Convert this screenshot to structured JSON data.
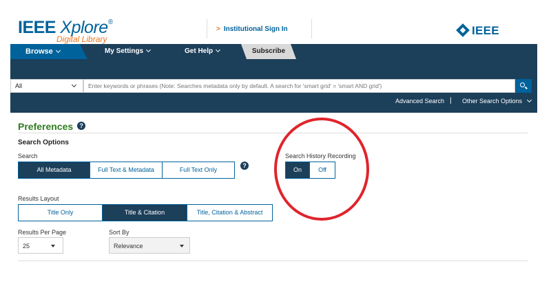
{
  "header": {
    "logo_text_bold": "IEEE ",
    "logo_text_italic": "Xplore",
    "logo_reg": "®",
    "logo_subtitle": "Digital Library",
    "institutional_sign_in": "Institutional Sign In",
    "ieee_logo": "IEEE"
  },
  "nav": {
    "browse": "Browse",
    "my_settings": "My Settings",
    "get_help": "Get Help",
    "subscribe": "Subscribe"
  },
  "search": {
    "scope_value": "All",
    "placeholder": "Enter keywords or phrases (Note: Searches metadata only by default. A search for 'smart grid' = 'smart AND grid')",
    "advanced_search": "Advanced Search",
    "separator": "|",
    "other_options": "Other Search Options"
  },
  "preferences": {
    "title": "Preferences",
    "help_glyph": "?",
    "section_title": "Search Options",
    "search_label": "Search",
    "search_buttons": [
      "All Metadata",
      "Full Text & Metadata",
      "Full Text Only"
    ],
    "search_selected": "All Metadata",
    "history_label": "Search History Recording",
    "history_buttons": [
      "On",
      "Off"
    ],
    "history_selected": "On",
    "results_layout_label": "Results Layout",
    "layout_buttons": [
      "Title Only",
      "Title & Citation",
      "Title, Citation & Abstract"
    ],
    "layout_selected": "Title & Citation",
    "per_page_label": "Results Per Page",
    "per_page_value": "25",
    "sort_label": "Sort By",
    "sort_value": "Relevance"
  },
  "colors": {
    "ieee_blue": "#00629b",
    "nav_dark": "#1c3f5a",
    "accent_orange": "#e87722",
    "pref_green": "#2e7d1f",
    "annotation_red": "#e0242b"
  }
}
